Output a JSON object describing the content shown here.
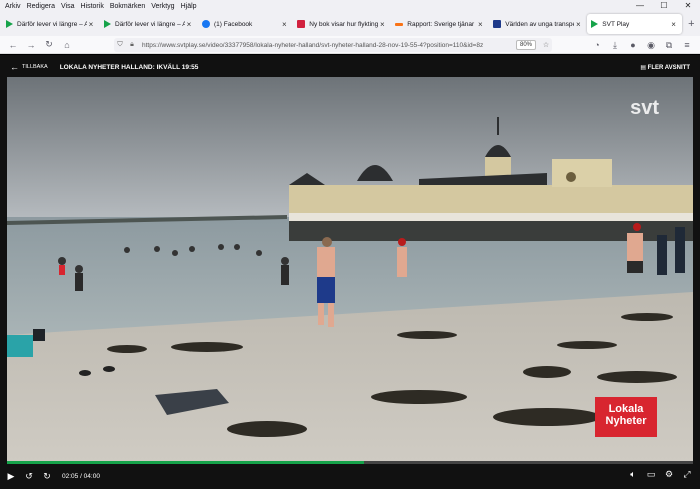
{
  "menu": [
    "Arkiv",
    "Redigera",
    "Visa",
    "Historik",
    "Bokmärken",
    "Verktyg",
    "Hjälp"
  ],
  "window_controls": [
    "—",
    "☐",
    "✕"
  ],
  "tabs": [
    {
      "label": "Därför lever vi längre – Avs",
      "favicon": "play-icon",
      "color": "#16a34a",
      "active": false
    },
    {
      "label": "Därför lever vi längre – Avs",
      "favicon": "play-icon",
      "color": "#16a34a",
      "active": false
    },
    {
      "label": "(1) Facebook",
      "favicon": "facebook-icon",
      "color": "#1877f2",
      "active": false
    },
    {
      "label": "Ny bok visar hur flyktingin",
      "favicon": "m-icon",
      "color": "#d1213e",
      "active": false
    },
    {
      "label": "Rapport: Sverige tjänar mil",
      "favicon": "arrow-icon",
      "color": "#f97316",
      "active": false
    },
    {
      "label": "Världen av unga transperso",
      "favicon": "gp-icon",
      "color": "#1e3a8a",
      "active": false
    },
    {
      "label": "SVT Play",
      "favicon": "play-icon",
      "color": "#16a34a",
      "active": true
    }
  ],
  "nav": {
    "url": "https://www.svtplay.se/video/33377958/lokala-nyheter-halland/svt-nyheter-halland-28-nov-19-55-4?position=110&id=8z",
    "zoom": "80%"
  },
  "player": {
    "back_label": "TILLBAKA",
    "title": "LOKALA NYHETER HALLAND: IKVÄLL 19:55",
    "more_label": "FLER AVSNITT",
    "channel_logo": "svt",
    "badge_line1": "Lokala",
    "badge_line2": "Nyheter",
    "time": "02:05 / 04:00",
    "progress": 0.52,
    "accent": "#16a34a"
  }
}
